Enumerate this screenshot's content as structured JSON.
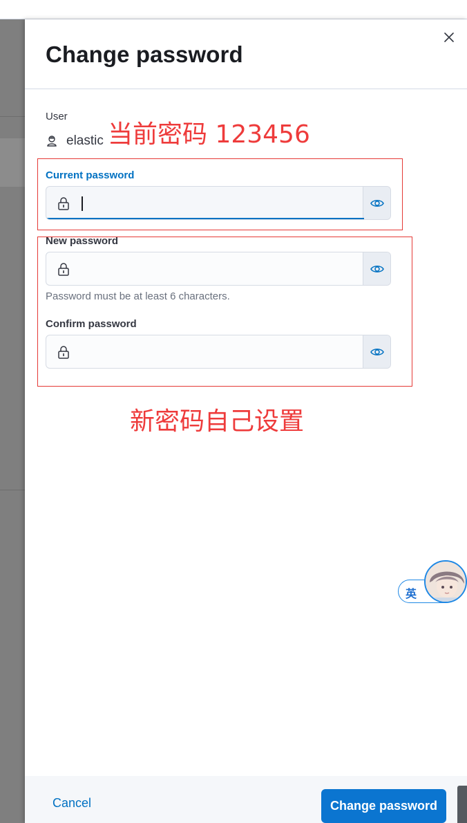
{
  "dialog": {
    "title": "Change password",
    "user_label": "User",
    "username": "elastic"
  },
  "fields": {
    "current": {
      "label": "Current password",
      "value": ""
    },
    "new": {
      "label": "New password",
      "value": "",
      "help": "Password must be at least 6 characters."
    },
    "confirm": {
      "label": "Confirm password",
      "value": ""
    }
  },
  "footer": {
    "cancel_label": "Cancel",
    "submit_label": "Change password"
  },
  "annotations": {
    "current_note": "当前密码 123456",
    "new_note": "新密码自己设置"
  },
  "widget": {
    "ime_label": "英"
  },
  "colors": {
    "primary": "#0b75d0",
    "link": "#0071c2",
    "annotation": "#ee3b3b"
  }
}
